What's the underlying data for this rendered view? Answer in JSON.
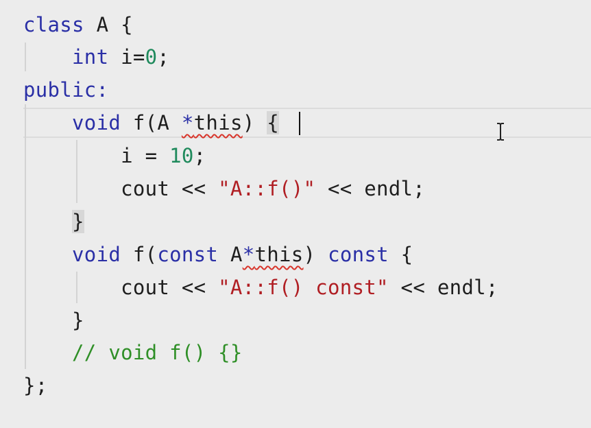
{
  "colors": {
    "background": "#ececec",
    "keyword": "#2a2fa6",
    "number": "#1f8a5c",
    "string": "#b01e23",
    "comment": "#2f8f27",
    "error_squiggle": "#d8352b"
  },
  "code": {
    "l1_kw": "class",
    "l1_rest": " A {",
    "l2_indent": "    ",
    "l2_kw": "int",
    "l2_mid": " i=",
    "l2_num": "0",
    "l2_end": ";",
    "l3_kw": "public:",
    "l4_indent": "    ",
    "l4_kw": "void",
    "l4_a": " f(A ",
    "l4_star": "*",
    "l4_this": "this",
    "l4_b": ") ",
    "l4_brace": "{",
    "l5_indent": "        ",
    "l5_a": "i = ",
    "l5_num": "10",
    "l5_end": ";",
    "l6_indent": "        ",
    "l6_a": "cout << ",
    "l6_str": "\"A::f()\"",
    "l6_b": " << endl;",
    "l7_indent": "    ",
    "l7_brace": "}",
    "l8_indent": "    ",
    "l8_kw1": "void",
    "l8_a": " f(",
    "l8_kw2": "const",
    "l8_b": " A",
    "l8_star": "*",
    "l8_this": "this",
    "l8_c": ") ",
    "l8_kw3": "const",
    "l8_d": " {",
    "l9_indent": "        ",
    "l9_a": "cout << ",
    "l9_str": "\"A::f() const\"",
    "l9_b": " << endl;",
    "l10_indent": "    ",
    "l10_brace": "}",
    "l11_indent": "    ",
    "l11_comment": "// void f() {}",
    "l12": "};"
  }
}
